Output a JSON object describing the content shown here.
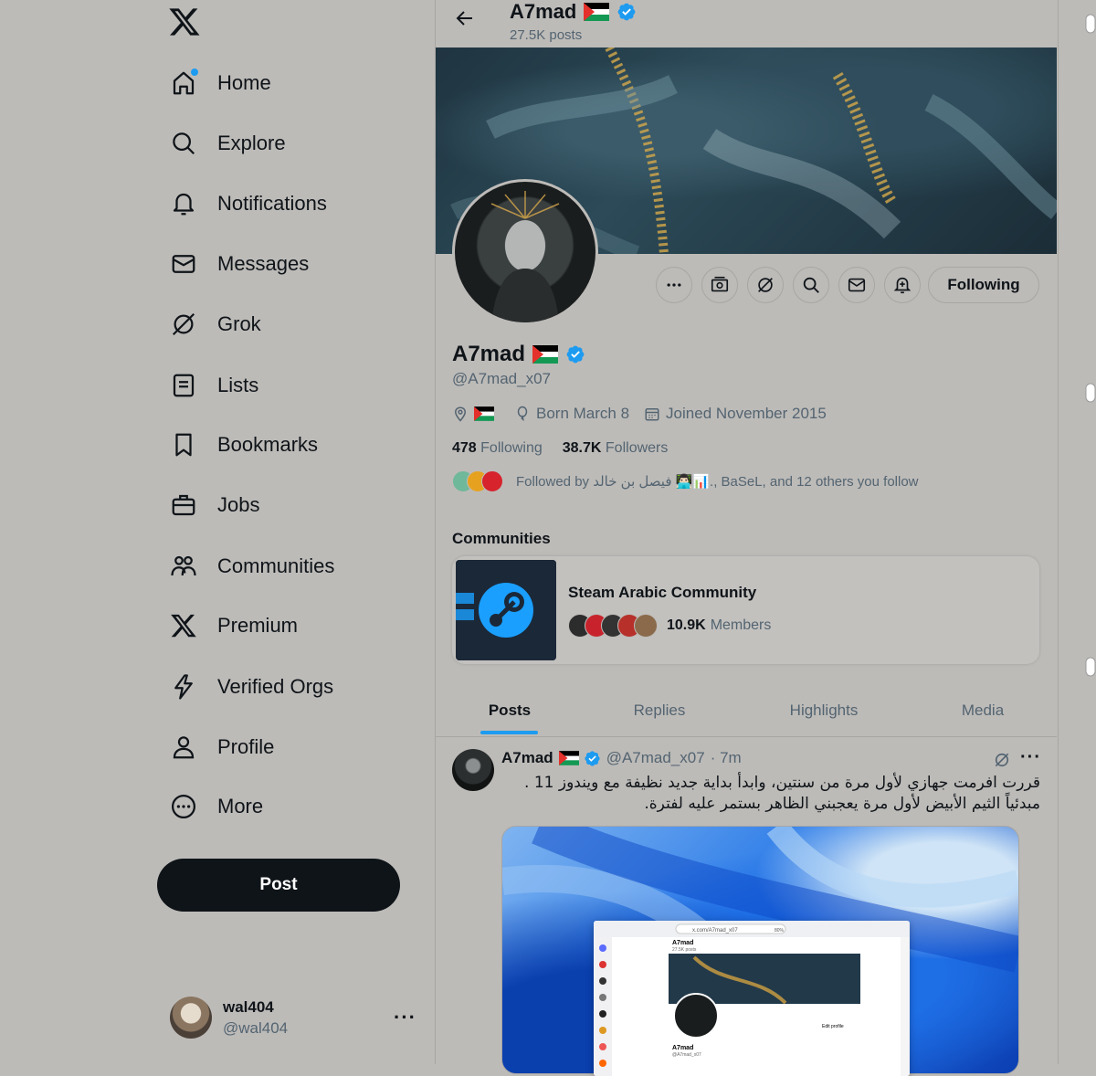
{
  "nav": {
    "items": [
      {
        "label": "Home",
        "icon": "home-icon"
      },
      {
        "label": "Explore",
        "icon": "search-icon"
      },
      {
        "label": "Notifications",
        "icon": "bell-icon"
      },
      {
        "label": "Messages",
        "icon": "envelope-icon"
      },
      {
        "label": "Grok",
        "icon": "grok-icon"
      },
      {
        "label": "Lists",
        "icon": "list-icon"
      },
      {
        "label": "Bookmarks",
        "icon": "bookmark-icon"
      },
      {
        "label": "Jobs",
        "icon": "briefcase-icon"
      },
      {
        "label": "Communities",
        "icon": "people-icon"
      },
      {
        "label": "Premium",
        "icon": "x-logo-icon"
      },
      {
        "label": "Verified Orgs",
        "icon": "lightning-icon"
      },
      {
        "label": "Profile",
        "icon": "person-icon"
      },
      {
        "label": "More",
        "icon": "more-circle-icon"
      }
    ],
    "post_label": "Post"
  },
  "account": {
    "name": "wal404",
    "handle": "@wal404",
    "more": "···"
  },
  "header": {
    "name": "A7mad",
    "posts": "27.5K posts"
  },
  "profile": {
    "name": "A7mad",
    "handle": "@A7mad_x07",
    "born": "Born March 8",
    "joined": "Joined November 2015",
    "following_count": "478",
    "following_label": "Following",
    "followers_count": "38.7K",
    "followers_label": "Followers",
    "followed_by": "Followed by فيصل بن خالد 👨🏻‍💻📊., BaSeL, and 12 others you follow",
    "following_button": "Following"
  },
  "communities": {
    "title": "Communities",
    "name": "Steam Arabic Community",
    "members_count": "10.9K",
    "members_label": "Members"
  },
  "tabs": [
    "Posts",
    "Replies",
    "Highlights",
    "Media"
  ],
  "tweet": {
    "name": "A7mad",
    "handle": "@A7mad_x07",
    "time": "· 7m",
    "line1": "قررت افرمت جهازي لأول مرة من سنتين، وابدأ بداية جديد نظيفة مع ويندوز 11 .",
    "line2": "مبدئياً الثيم الأبيض لأول مرة يعجبني الظاهر بستمر عليه لفترة."
  },
  "screenshot_preview": {
    "url": "x.com/A7mad_x07",
    "name": "A7mad",
    "posts": "27.5K posts",
    "edit": "Edit profile",
    "handle": "@A7mad_x07",
    "zoom": "80%"
  },
  "colors": {
    "accent": "#1d9bf0",
    "verified": "#1d9bf0",
    "post_button": "#0f1419"
  }
}
